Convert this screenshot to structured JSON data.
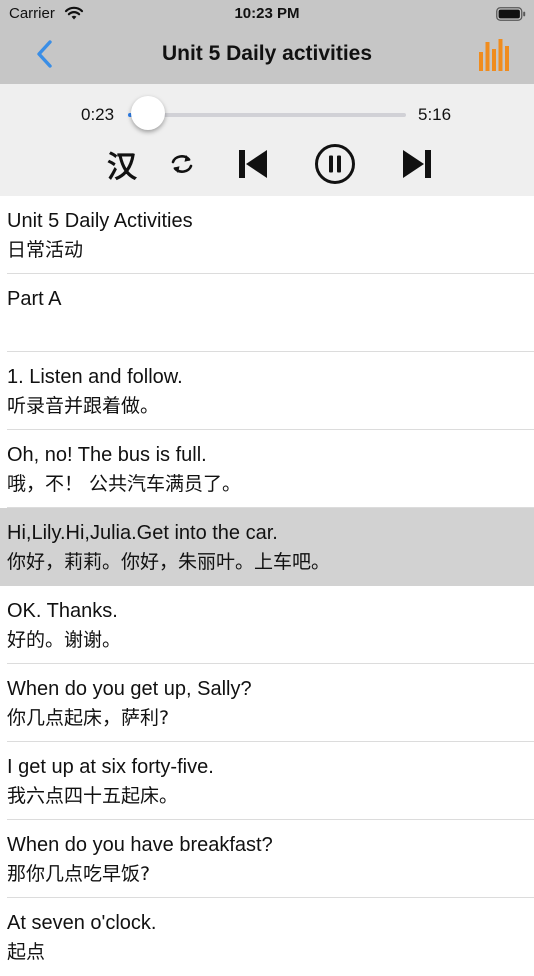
{
  "status_bar": {
    "carrier": "Carrier",
    "time": "10:23 PM"
  },
  "nav": {
    "title": "Unit 5 Daily activities",
    "back_icon": "chevron-left-icon",
    "menu_icon": "equalizer-icon"
  },
  "player": {
    "current_time": "0:23",
    "total_time": "5:16",
    "progress": 0.073,
    "han_toggle": "汉",
    "accent_color": "#2f80ed"
  },
  "lines": [
    {
      "en": "Unit 5 Daily Activities",
      "zh": "日常活动",
      "highlighted": false
    },
    {
      "en": "Part A",
      "zh": "",
      "highlighted": false
    },
    {
      "en": "1. Listen and follow.",
      "zh": "听录音并跟着做。",
      "highlighted": false
    },
    {
      "en": "Oh, no! The bus is full.",
      "zh": "哦，不！ 公共汽车满员了。",
      "highlighted": false
    },
    {
      "en": "Hi,Lily.Hi,Julia.Get into the car.",
      "zh": "你好，莉莉。你好，朱丽叶。上车吧。",
      "highlighted": true
    },
    {
      "en": "OK. Thanks.",
      "zh": "好的。谢谢。",
      "highlighted": false
    },
    {
      "en": "When do you get up, Sally?",
      "zh": "你几点起床，萨利?",
      "highlighted": false
    },
    {
      "en": "I get up at six forty-five.",
      "zh": "我六点四十五起床。",
      "highlighted": false
    },
    {
      "en": "When do you have breakfast?",
      "zh": "那你几点吃早饭?",
      "highlighted": false
    },
    {
      "en": "At seven o'clock.",
      "zh": "起点",
      "highlighted": false
    }
  ]
}
